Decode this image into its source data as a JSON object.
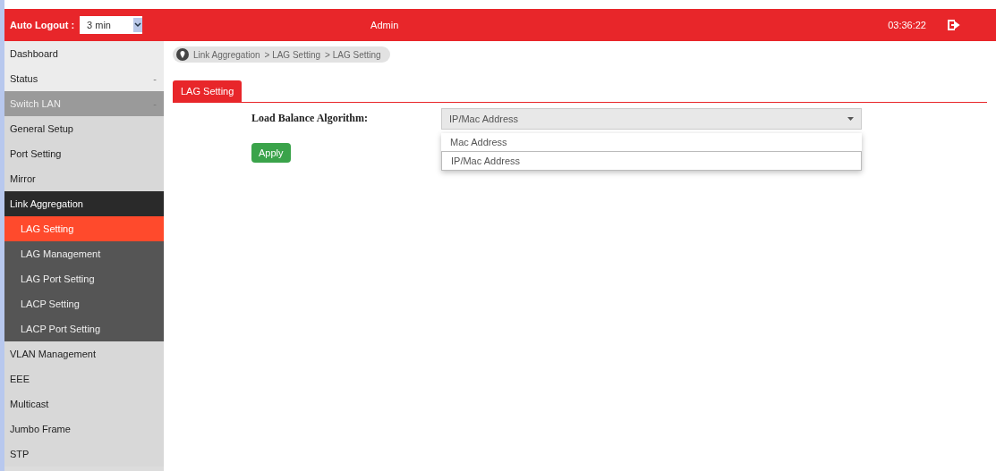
{
  "header": {
    "auto_logout_label": "Auto Logout :",
    "auto_logout_value": "3 min",
    "user": "Admin",
    "time": "03:36:22"
  },
  "sidebar": {
    "items": [
      {
        "label": "Dashboard",
        "expanded": false,
        "selected": false
      },
      {
        "label": "Status",
        "expanded": false,
        "selected": false,
        "caret": "-"
      },
      {
        "label": "Switch LAN",
        "expanded": true,
        "selected": false,
        "caret": "-",
        "children": [
          {
            "label": "General Setup",
            "selected": false
          },
          {
            "label": "Port Setting",
            "selected": false
          },
          {
            "label": "Mirror",
            "selected": false
          },
          {
            "label": "Link Aggregation",
            "expanded": true,
            "selected": false,
            "children": [
              {
                "label": "LAG Setting",
                "selected": true
              },
              {
                "label": "LAG Management",
                "selected": false
              },
              {
                "label": "LAG Port Setting",
                "selected": false
              },
              {
                "label": "LACP Setting",
                "selected": false
              },
              {
                "label": "LACP Port Setting",
                "selected": false
              }
            ]
          },
          {
            "label": "VLAN Management",
            "selected": false
          },
          {
            "label": "EEE",
            "selected": false
          },
          {
            "label": "Multicast",
            "selected": false
          },
          {
            "label": "Jumbo Frame",
            "selected": false
          },
          {
            "label": "STP",
            "selected": false
          }
        ]
      }
    ]
  },
  "breadcrumb": [
    "Link Aggregation",
    "> LAG Setting",
    "> LAG Setting"
  ],
  "tabs": [
    {
      "label": "LAG Setting",
      "selected": true
    }
  ],
  "form": {
    "label": "Load Balance Algorithm:",
    "value": "IP/Mac Address",
    "options": [
      {
        "label": "Mac Address",
        "selected": false
      },
      {
        "label": "IP/Mac Address",
        "selected": true
      }
    ],
    "button": "Apply"
  }
}
